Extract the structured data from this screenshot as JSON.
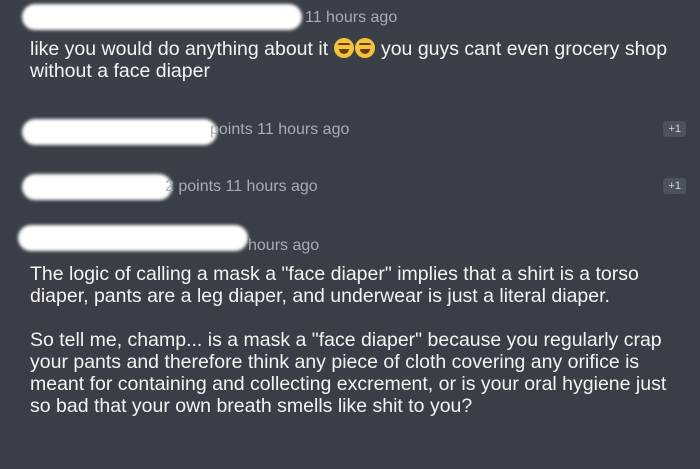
{
  "comments": [
    {
      "meta": "11 hours ago",
      "text_before_emoji": "like you would do anything about it ",
      "emojis": [
        "joy-emoji",
        "joy-emoji"
      ],
      "text_after_emoji": " you guys cant even grocery shop without a face diaper"
    },
    {
      "meta": "points 11 hours ago",
      "badge": "+1"
    },
    {
      "meta": "2 points 11 hours ago",
      "badge": "+1"
    },
    {
      "meta": "hours ago",
      "paragraphs": [
        "The logic of calling a mask a \"face diaper\" implies that a shirt is a torso diaper, pants are a leg diaper, and underwear is just a literal diaper.",
        "So tell me, champ... is a mask a \"face diaper\" because you regularly crap your pants and therefore think any piece of cloth covering any orifice is meant for containing and collecting excrement, or is your oral hygiene just so bad that your own breath smells like shit to you?"
      ]
    }
  ],
  "colors": {
    "background": "#3a3f47",
    "thread_bar_top": "#4a8ff0",
    "thread_bar_nested": "#9a2fb3",
    "meta_text": "#a8adb4",
    "body_text": "#f3f3f3"
  }
}
